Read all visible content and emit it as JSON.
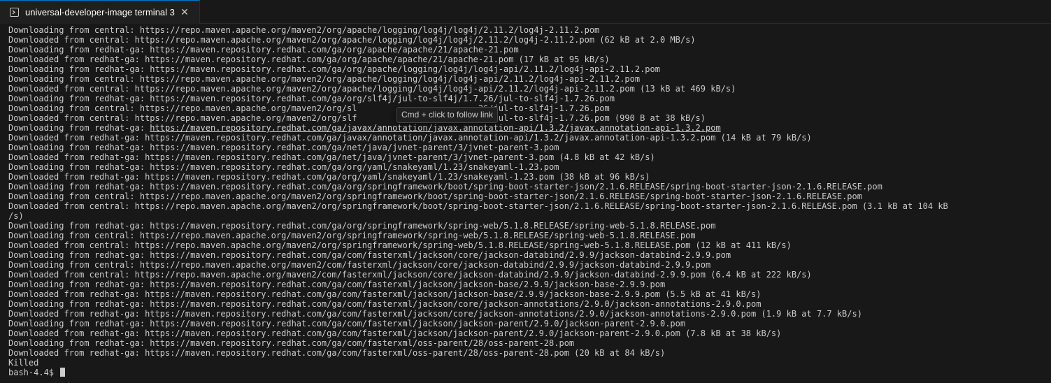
{
  "tab": {
    "icon": "terminal-icon",
    "title": "universal-developer-image terminal 3",
    "close_glyph": "✕",
    "close_icon": "close-icon"
  },
  "tooltip": {
    "text": "Cmd + click to follow link"
  },
  "hovered_link": {
    "prefix": "Downloading from redhat-ga: ",
    "url": "https://maven.repository.redhat.com/ga/javax/annotation/javax.annotation-api/1.3.2/javax.annotation-api-1.3.2.pom"
  },
  "terminal": {
    "lines": [
      "Downloading from central: https://repo.maven.apache.org/maven2/org/apache/logging/log4j/log4j/2.11.2/log4j-2.11.2.pom",
      "Downloaded from central: https://repo.maven.apache.org/maven2/org/apache/logging/log4j/log4j/2.11.2/log4j-2.11.2.pom (62 kB at 2.0 MB/s)",
      "Downloading from redhat-ga: https://maven.repository.redhat.com/ga/org/apache/apache/21/apache-21.pom",
      "Downloaded from redhat-ga: https://maven.repository.redhat.com/ga/org/apache/apache/21/apache-21.pom (17 kB at 95 kB/s)",
      "Downloading from redhat-ga: https://maven.repository.redhat.com/ga/org/apache/logging/log4j/log4j-api/2.11.2/log4j-api-2.11.2.pom",
      "Downloading from central: https://repo.maven.apache.org/maven2/org/apache/logging/log4j/log4j-api/2.11.2/log4j-api-2.11.2.pom",
      "Downloaded from central: https://repo.maven.apache.org/maven2/org/apache/logging/log4j/log4j-api/2.11.2/log4j-api-2.11.2.pom (13 kB at 469 kB/s)",
      "Downloading from redhat-ga: https://maven.repository.redhat.com/ga/org/slf4j/jul-to-slf4j/1.7.26/jul-to-slf4j-1.7.26.pom",
      "Downloading from central: https://repo.maven.apache.org/maven2/org/sl                        26/jul-to-slf4j-1.7.26.pom",
      "Downloaded from central: https://repo.maven.apache.org/maven2/org/slf                        26/jul-to-slf4j-1.7.26.pom (990 B at 38 kB/s)",
      "__HOVER_LINK__",
      "Downloaded from redhat-ga: https://maven.repository.redhat.com/ga/javax/annotation/javax.annotation-api/1.3.2/javax.annotation-api-1.3.2.pom (14 kB at 79 kB/s)",
      "Downloading from redhat-ga: https://maven.repository.redhat.com/ga/net/java/jvnet-parent/3/jvnet-parent-3.pom",
      "Downloaded from redhat-ga: https://maven.repository.redhat.com/ga/net/java/jvnet-parent/3/jvnet-parent-3.pom (4.8 kB at 42 kB/s)",
      "Downloading from redhat-ga: https://maven.repository.redhat.com/ga/org/yaml/snakeyaml/1.23/snakeyaml-1.23.pom",
      "Downloaded from redhat-ga: https://maven.repository.redhat.com/ga/org/yaml/snakeyaml/1.23/snakeyaml-1.23.pom (38 kB at 96 kB/s)",
      "Downloading from redhat-ga: https://maven.repository.redhat.com/ga/org/springframework/boot/spring-boot-starter-json/2.1.6.RELEASE/spring-boot-starter-json-2.1.6.RELEASE.pom",
      "Downloading from central: https://repo.maven.apache.org/maven2/org/springframework/boot/spring-boot-starter-json/2.1.6.RELEASE/spring-boot-starter-json-2.1.6.RELEASE.pom",
      "Downloaded from central: https://repo.maven.apache.org/maven2/org/springframework/boot/spring-boot-starter-json/2.1.6.RELEASE/spring-boot-starter-json-2.1.6.RELEASE.pom (3.1 kB at 104 kB",
      "/s)",
      "Downloading from redhat-ga: https://maven.repository.redhat.com/ga/org/springframework/spring-web/5.1.8.RELEASE/spring-web-5.1.8.RELEASE.pom",
      "Downloading from central: https://repo.maven.apache.org/maven2/org/springframework/spring-web/5.1.8.RELEASE/spring-web-5.1.8.RELEASE.pom",
      "Downloaded from central: https://repo.maven.apache.org/maven2/org/springframework/spring-web/5.1.8.RELEASE/spring-web-5.1.8.RELEASE.pom (12 kB at 411 kB/s)",
      "Downloading from redhat-ga: https://maven.repository.redhat.com/ga/com/fasterxml/jackson/core/jackson-databind/2.9.9/jackson-databind-2.9.9.pom",
      "Downloading from central: https://repo.maven.apache.org/maven2/com/fasterxml/jackson/core/jackson-databind/2.9.9/jackson-databind-2.9.9.pom",
      "Downloaded from central: https://repo.maven.apache.org/maven2/com/fasterxml/jackson/core/jackson-databind/2.9.9/jackson-databind-2.9.9.pom (6.4 kB at 222 kB/s)",
      "Downloading from redhat-ga: https://maven.repository.redhat.com/ga/com/fasterxml/jackson/jackson-base/2.9.9/jackson-base-2.9.9.pom",
      "Downloaded from redhat-ga: https://maven.repository.redhat.com/ga/com/fasterxml/jackson/jackson-base/2.9.9/jackson-base-2.9.9.pom (5.5 kB at 41 kB/s)",
      "Downloading from redhat-ga: https://maven.repository.redhat.com/ga/com/fasterxml/jackson/core/jackson-annotations/2.9.0/jackson-annotations-2.9.0.pom",
      "Downloaded from redhat-ga: https://maven.repository.redhat.com/ga/com/fasterxml/jackson/core/jackson-annotations/2.9.0/jackson-annotations-2.9.0.pom (1.9 kB at 7.7 kB/s)",
      "Downloading from redhat-ga: https://maven.repository.redhat.com/ga/com/fasterxml/jackson/jackson-parent/2.9.0/jackson-parent-2.9.0.pom",
      "Downloaded from redhat-ga: https://maven.repository.redhat.com/ga/com/fasterxml/jackson/jackson-parent/2.9.0/jackson-parent-2.9.0.pom (7.8 kB at 38 kB/s)",
      "Downloading from redhat-ga: https://maven.repository.redhat.com/ga/com/fasterxml/oss-parent/28/oss-parent-28.pom",
      "Downloaded from redhat-ga: https://maven.repository.redhat.com/ga/com/fasterxml/oss-parent/28/oss-parent-28.pom (20 kB at 84 kB/s)",
      "Killed"
    ],
    "prompt": "bash-4.4$ "
  }
}
